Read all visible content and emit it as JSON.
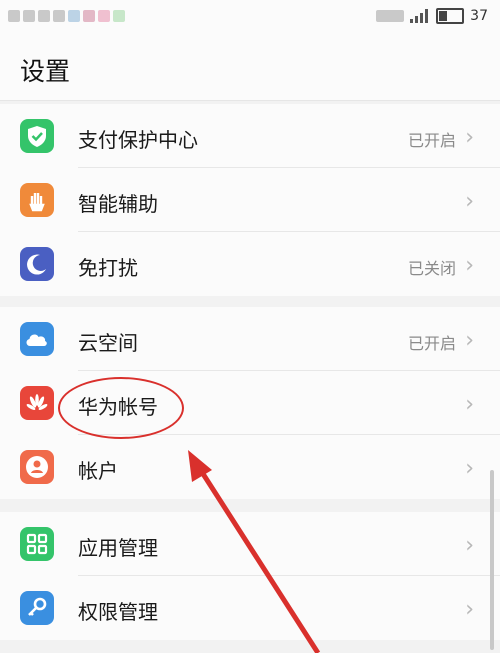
{
  "status_bar": {
    "left_blurred": "",
    "right_text": "37",
    "battery_level": 0.3
  },
  "header": {
    "title": "设置"
  },
  "groups": [
    {
      "items": [
        {
          "icon": "shield-check-icon",
          "label": "支付保护中心",
          "value": "已开启"
        },
        {
          "icon": "hand-icon",
          "label": "智能辅助",
          "value": ""
        },
        {
          "icon": "moon-icon",
          "label": "免打扰",
          "value": "已关闭"
        }
      ]
    },
    {
      "items": [
        {
          "icon": "cloud-icon",
          "label": "云空间",
          "value": "已开启"
        },
        {
          "icon": "huawei-logo-icon",
          "label": "华为帐号",
          "value": ""
        },
        {
          "icon": "user-icon",
          "label": "帐户",
          "value": ""
        }
      ]
    },
    {
      "items": [
        {
          "icon": "apps-grid-icon",
          "label": "应用管理",
          "value": ""
        },
        {
          "icon": "key-icon",
          "label": "权限管理",
          "value": ""
        }
      ]
    }
  ],
  "colors": {
    "green": "#34c46a",
    "orange": "#f08a3a",
    "indigo": "#4a5fc2",
    "cloud_blue": "#3a8fe0",
    "huawei_red": "#e8463a",
    "user_orange": "#f06a4a",
    "annotation_red": "#d9302c"
  }
}
